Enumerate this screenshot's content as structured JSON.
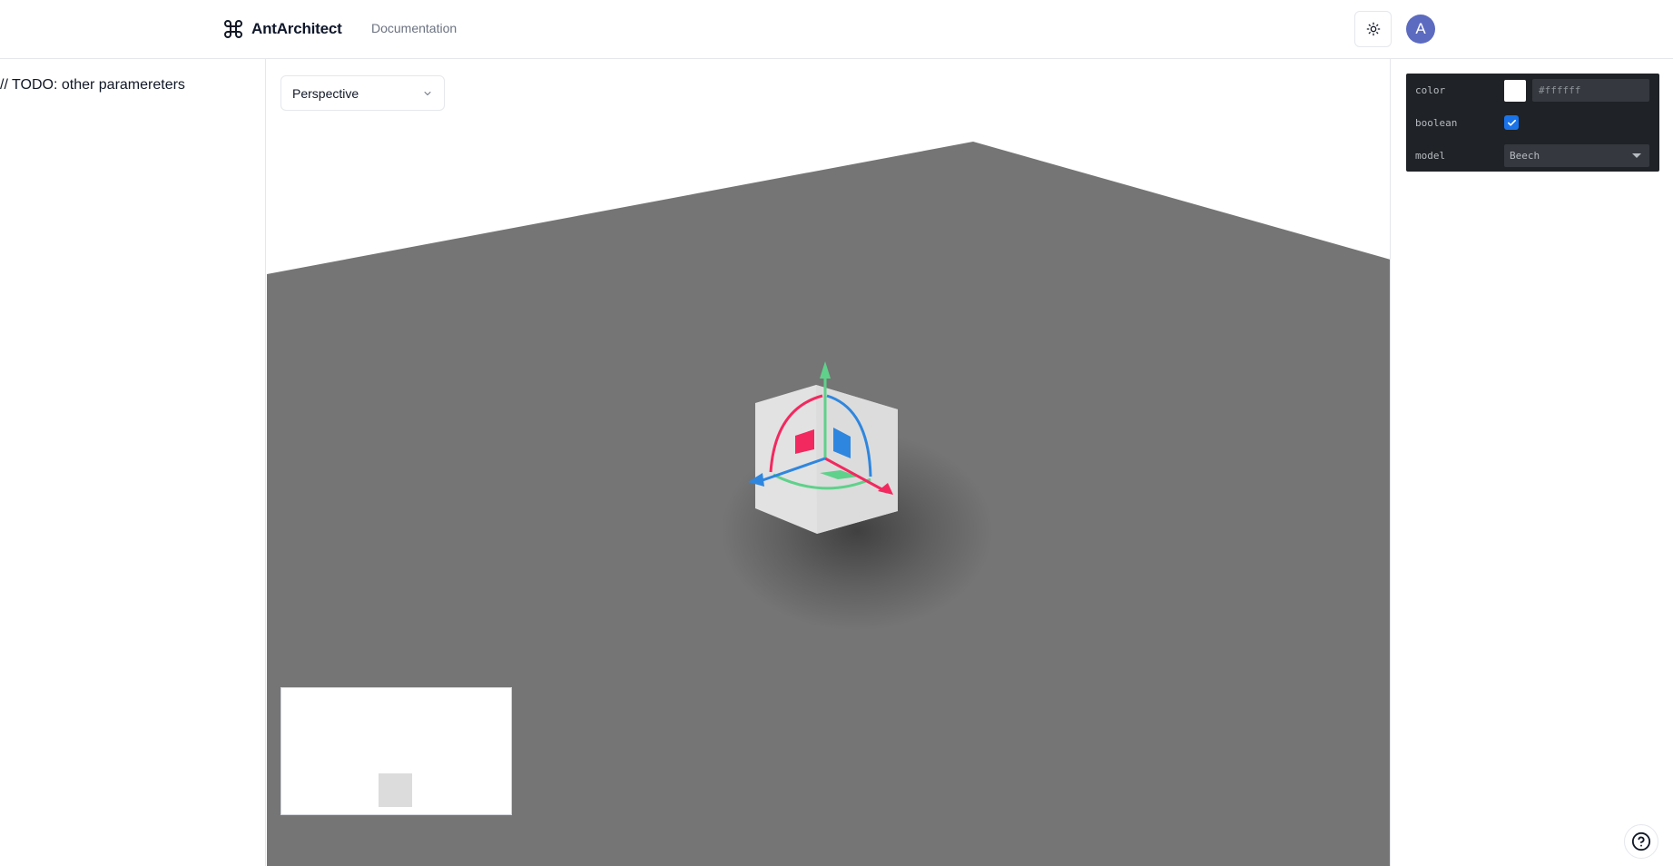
{
  "header": {
    "brand_name": "AntArchitect",
    "brand_icon": "command-icon",
    "nav_documentation": "Documentation",
    "theme_toggle_icon": "sun-icon",
    "avatar_letter": "A"
  },
  "sidebar": {
    "todo_text": "// TODO: other paramereters"
  },
  "viewport": {
    "camera_mode": "Perspective",
    "camera_dropdown_icon": "chevron-down-icon",
    "floor_color": "#757575",
    "object_color": "#e0e0e0",
    "gizmo_colors": {
      "x_axis": "#f2295f",
      "y_axis": "#5fd18a",
      "z_axis": "#2f86de"
    }
  },
  "controls": {
    "color": {
      "label": "color",
      "value": "#ffffff"
    },
    "boolean": {
      "label": "boolean",
      "checked": true
    },
    "model": {
      "label": "model",
      "value": "Beech"
    }
  },
  "help_icon": "help-circle-icon"
}
